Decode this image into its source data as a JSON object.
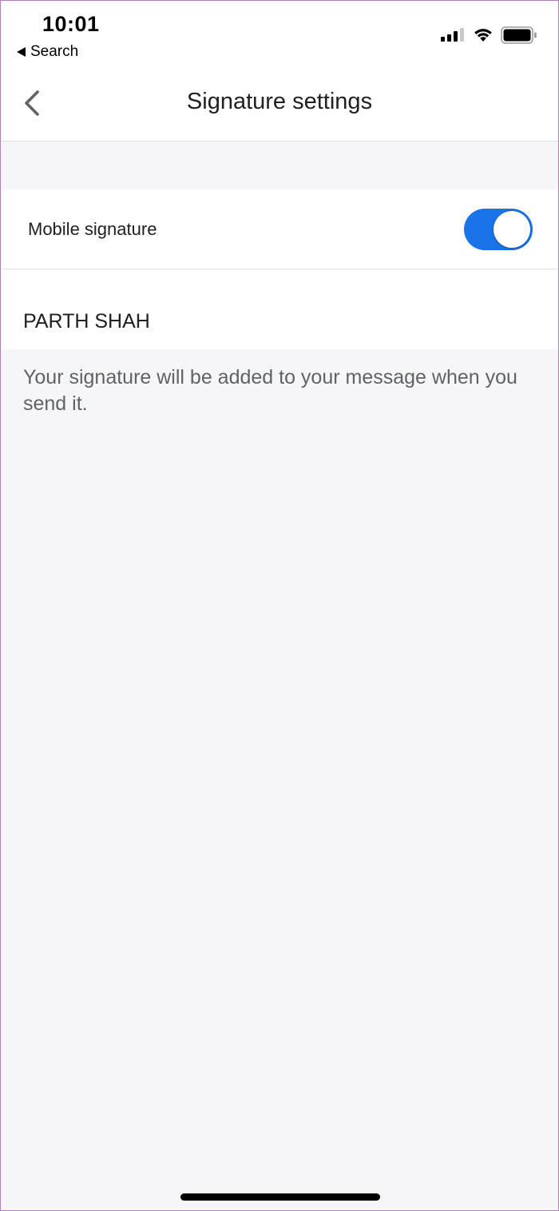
{
  "status_bar": {
    "time": "10:01",
    "back_app_label": "Search"
  },
  "header": {
    "title": "Signature settings"
  },
  "settings": {
    "mobile_signature_label": "Mobile signature",
    "mobile_signature_enabled": true,
    "signature_value": "PARTH SHAH",
    "helper_text": "Your signature will be added to your message when you send it."
  },
  "colors": {
    "accent": "#1a73e8",
    "background": "#f6f6f9",
    "surface": "#ffffff",
    "text_primary": "#202124",
    "text_secondary": "#5f6368"
  },
  "icons": {
    "back": "chevron-left-icon",
    "signal": "cellular-signal-icon",
    "wifi": "wifi-icon",
    "battery": "battery-icon"
  }
}
